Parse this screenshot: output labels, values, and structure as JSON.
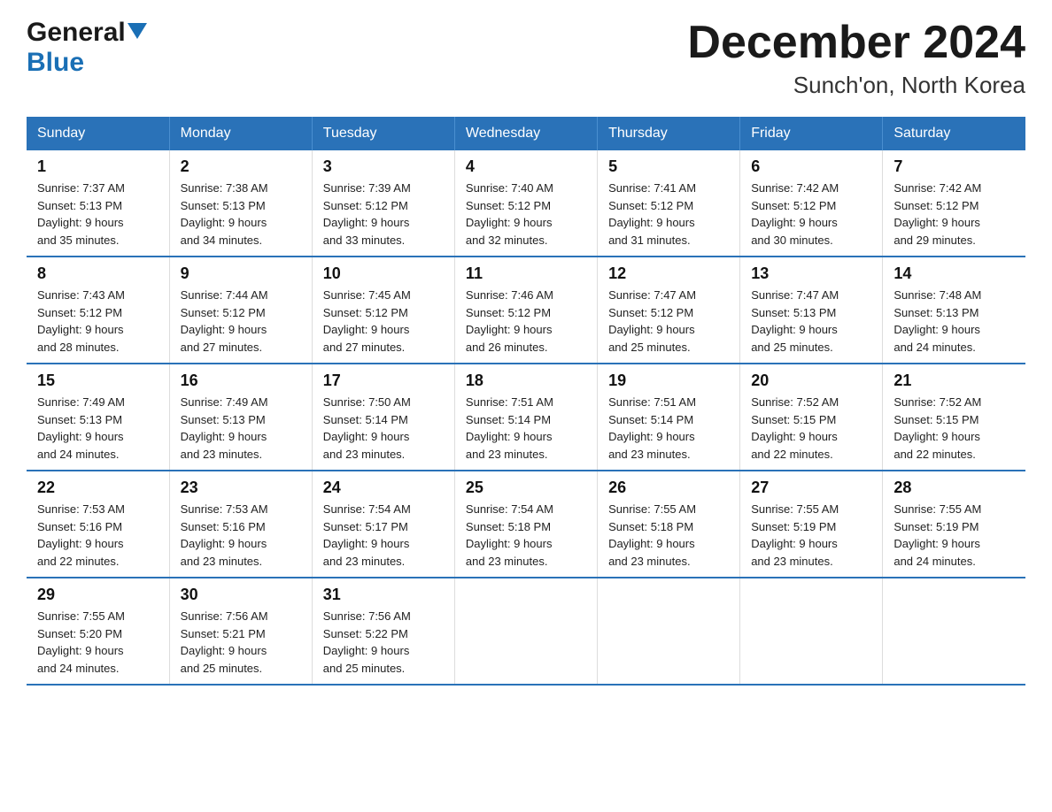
{
  "header": {
    "logo_general": "General",
    "logo_blue": "Blue",
    "title": "December 2024",
    "subtitle": "Sunch'on, North Korea"
  },
  "calendar": {
    "days_of_week": [
      "Sunday",
      "Monday",
      "Tuesday",
      "Wednesday",
      "Thursday",
      "Friday",
      "Saturday"
    ],
    "weeks": [
      [
        {
          "day": "1",
          "sunrise": "7:37 AM",
          "sunset": "5:13 PM",
          "daylight": "9 hours and 35 minutes."
        },
        {
          "day": "2",
          "sunrise": "7:38 AM",
          "sunset": "5:13 PM",
          "daylight": "9 hours and 34 minutes."
        },
        {
          "day": "3",
          "sunrise": "7:39 AM",
          "sunset": "5:12 PM",
          "daylight": "9 hours and 33 minutes."
        },
        {
          "day": "4",
          "sunrise": "7:40 AM",
          "sunset": "5:12 PM",
          "daylight": "9 hours and 32 minutes."
        },
        {
          "day": "5",
          "sunrise": "7:41 AM",
          "sunset": "5:12 PM",
          "daylight": "9 hours and 31 minutes."
        },
        {
          "day": "6",
          "sunrise": "7:42 AM",
          "sunset": "5:12 PM",
          "daylight": "9 hours and 30 minutes."
        },
        {
          "day": "7",
          "sunrise": "7:42 AM",
          "sunset": "5:12 PM",
          "daylight": "9 hours and 29 minutes."
        }
      ],
      [
        {
          "day": "8",
          "sunrise": "7:43 AM",
          "sunset": "5:12 PM",
          "daylight": "9 hours and 28 minutes."
        },
        {
          "day": "9",
          "sunrise": "7:44 AM",
          "sunset": "5:12 PM",
          "daylight": "9 hours and 27 minutes."
        },
        {
          "day": "10",
          "sunrise": "7:45 AM",
          "sunset": "5:12 PM",
          "daylight": "9 hours and 27 minutes."
        },
        {
          "day": "11",
          "sunrise": "7:46 AM",
          "sunset": "5:12 PM",
          "daylight": "9 hours and 26 minutes."
        },
        {
          "day": "12",
          "sunrise": "7:47 AM",
          "sunset": "5:12 PM",
          "daylight": "9 hours and 25 minutes."
        },
        {
          "day": "13",
          "sunrise": "7:47 AM",
          "sunset": "5:13 PM",
          "daylight": "9 hours and 25 minutes."
        },
        {
          "day": "14",
          "sunrise": "7:48 AM",
          "sunset": "5:13 PM",
          "daylight": "9 hours and 24 minutes."
        }
      ],
      [
        {
          "day": "15",
          "sunrise": "7:49 AM",
          "sunset": "5:13 PM",
          "daylight": "9 hours and 24 minutes."
        },
        {
          "day": "16",
          "sunrise": "7:49 AM",
          "sunset": "5:13 PM",
          "daylight": "9 hours and 23 minutes."
        },
        {
          "day": "17",
          "sunrise": "7:50 AM",
          "sunset": "5:14 PM",
          "daylight": "9 hours and 23 minutes."
        },
        {
          "day": "18",
          "sunrise": "7:51 AM",
          "sunset": "5:14 PM",
          "daylight": "9 hours and 23 minutes."
        },
        {
          "day": "19",
          "sunrise": "7:51 AM",
          "sunset": "5:14 PM",
          "daylight": "9 hours and 23 minutes."
        },
        {
          "day": "20",
          "sunrise": "7:52 AM",
          "sunset": "5:15 PM",
          "daylight": "9 hours and 22 minutes."
        },
        {
          "day": "21",
          "sunrise": "7:52 AM",
          "sunset": "5:15 PM",
          "daylight": "9 hours and 22 minutes."
        }
      ],
      [
        {
          "day": "22",
          "sunrise": "7:53 AM",
          "sunset": "5:16 PM",
          "daylight": "9 hours and 22 minutes."
        },
        {
          "day": "23",
          "sunrise": "7:53 AM",
          "sunset": "5:16 PM",
          "daylight": "9 hours and 23 minutes."
        },
        {
          "day": "24",
          "sunrise": "7:54 AM",
          "sunset": "5:17 PM",
          "daylight": "9 hours and 23 minutes."
        },
        {
          "day": "25",
          "sunrise": "7:54 AM",
          "sunset": "5:18 PM",
          "daylight": "9 hours and 23 minutes."
        },
        {
          "day": "26",
          "sunrise": "7:55 AM",
          "sunset": "5:18 PM",
          "daylight": "9 hours and 23 minutes."
        },
        {
          "day": "27",
          "sunrise": "7:55 AM",
          "sunset": "5:19 PM",
          "daylight": "9 hours and 23 minutes."
        },
        {
          "day": "28",
          "sunrise": "7:55 AM",
          "sunset": "5:19 PM",
          "daylight": "9 hours and 24 minutes."
        }
      ],
      [
        {
          "day": "29",
          "sunrise": "7:55 AM",
          "sunset": "5:20 PM",
          "daylight": "9 hours and 24 minutes."
        },
        {
          "day": "30",
          "sunrise": "7:56 AM",
          "sunset": "5:21 PM",
          "daylight": "9 hours and 25 minutes."
        },
        {
          "day": "31",
          "sunrise": "7:56 AM",
          "sunset": "5:22 PM",
          "daylight": "9 hours and 25 minutes."
        },
        null,
        null,
        null,
        null
      ]
    ],
    "labels": {
      "sunrise": "Sunrise:",
      "sunset": "Sunset:",
      "daylight": "Daylight:"
    }
  }
}
